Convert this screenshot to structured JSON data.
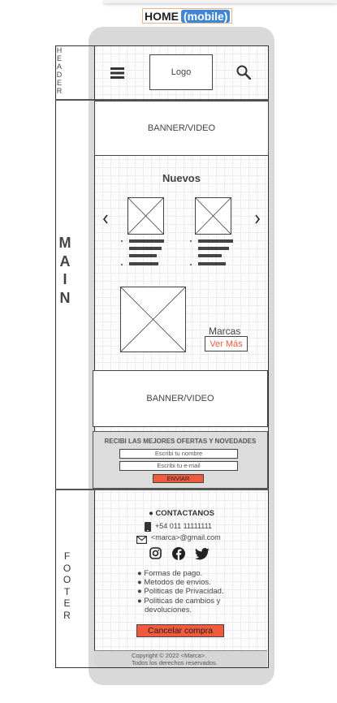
{
  "page_title": {
    "main": "HOME",
    "highlight": "(mobile)"
  },
  "side_labels": {
    "header": "H\nE\nA\nD\nE\nR",
    "main": "M\nA\nI\nN",
    "footer": "F\nO\nO\nT\nE\nR"
  },
  "header": {
    "logo": "Logo",
    "menu_icon": "hamburger-icon",
    "search_icon": "search-icon"
  },
  "banner_top": "BANNER/VIDEO",
  "new_products": {
    "title": "Nuevos",
    "prev_icon": "chevron-left-icon",
    "next_icon": "chevron-right-icon"
  },
  "brands": {
    "label": "Marcas",
    "link": "Ver Más"
  },
  "banner_bottom": "BANNER/VIDEO",
  "newsletter": {
    "title": "RECIBI LAS MEJORES OFERTAS Y NOVEDADES",
    "name_placeholder": "Escribi tu nombre",
    "email_placeholder": "Escribi tu e-mail",
    "submit": "ENVIAR"
  },
  "footer": {
    "contact_title": "● CONTACTANOS",
    "phone": "+54 011 11111111",
    "email": "<marca>@gmail.com",
    "social_icons": [
      "instagram-icon",
      "facebook-icon",
      "twitter-icon"
    ],
    "links": [
      "● Formas de pago.",
      "● Metodos de envios.",
      "● Politicas de Privacidad.",
      "● Politicas de cambios y",
      "devoluciones."
    ],
    "cancel_button": "Cancelar compra",
    "copyright_1": "Copyright © 2022 <Marca>.",
    "copyright_2": "Todos los derechos reservados."
  },
  "colors": {
    "accent": "#f15a3c",
    "title_highlight": "#3f86d4",
    "phone_frame": "#d9d9d9",
    "newsletter_bg": "#dcdcdc"
  }
}
